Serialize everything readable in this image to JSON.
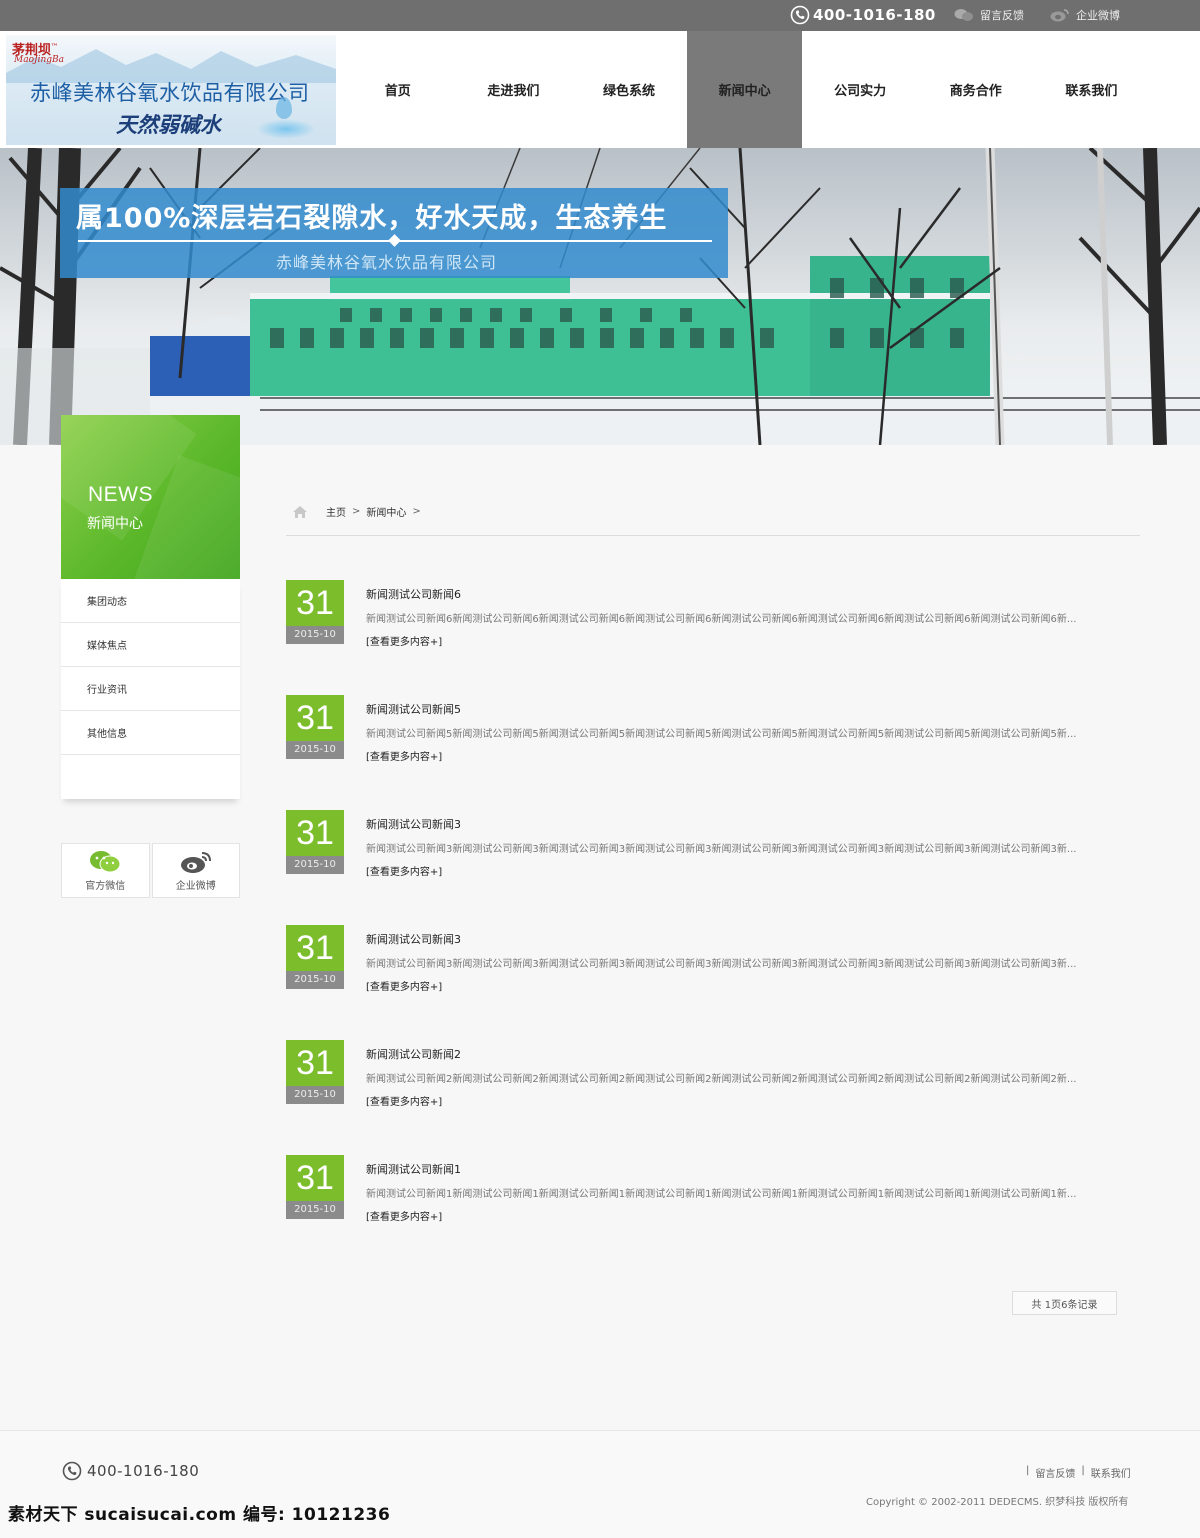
{
  "topbar": {
    "phone": "400-1016-180",
    "feedback": "留言反馈",
    "weibo": "企业微博"
  },
  "logo": {
    "brand_cn": "茅荆坝",
    "brand_tm": "™",
    "brand_en": "MaoJingBa",
    "company": "赤峰美林谷氧水饮品有限公司",
    "slogan": "天然弱碱水"
  },
  "nav": {
    "items": [
      "首页",
      "走进我们",
      "绿色系统",
      "新闻中心",
      "公司实力",
      "商务合作",
      "联系我们"
    ],
    "active_index": 3
  },
  "banner": {
    "headline": "属100%深层岩石裂隙水，好水天成，生态养生",
    "subline": "赤峰美林谷氧水饮品有限公司"
  },
  "sidebar": {
    "title_en": "NEWS",
    "title_cn": "新闻中心",
    "menu": [
      "集团动态",
      "媒体焦点",
      "行业资讯",
      "其他信息"
    ],
    "social": [
      {
        "label": "官方微信",
        "icon": "wechat-icon"
      },
      {
        "label": "企业微博",
        "icon": "weibo-icon"
      }
    ]
  },
  "breadcrumb": {
    "home": "主页",
    "current": "新闻中心",
    "separator": ">"
  },
  "news": [
    {
      "day": "31",
      "ym": "2015-10",
      "title": "新闻测试公司新闻6",
      "summary": "新闻测试公司新闻6新闻测试公司新闻6新闻测试公司新闻6新闻测试公司新闻6新闻测试公司新闻6新闻测试公司新闻6新闻测试公司新闻6新闻测试公司新闻6新...",
      "more": "[查看更多内容+]"
    },
    {
      "day": "31",
      "ym": "2015-10",
      "title": "新闻测试公司新闻5",
      "summary": "新闻测试公司新闻5新闻测试公司新闻5新闻测试公司新闻5新闻测试公司新闻5新闻测试公司新闻5新闻测试公司新闻5新闻测试公司新闻5新闻测试公司新闻5新...",
      "more": "[查看更多内容+]"
    },
    {
      "day": "31",
      "ym": "2015-10",
      "title": "新闻测试公司新闻3",
      "summary": "新闻测试公司新闻3新闻测试公司新闻3新闻测试公司新闻3新闻测试公司新闻3新闻测试公司新闻3新闻测试公司新闻3新闻测试公司新闻3新闻测试公司新闻3新...",
      "more": "[查看更多内容+]"
    },
    {
      "day": "31",
      "ym": "2015-10",
      "title": "新闻测试公司新闻3",
      "summary": "新闻测试公司新闻3新闻测试公司新闻3新闻测试公司新闻3新闻测试公司新闻3新闻测试公司新闻3新闻测试公司新闻3新闻测试公司新闻3新闻测试公司新闻3新...",
      "more": "[查看更多内容+]"
    },
    {
      "day": "31",
      "ym": "2015-10",
      "title": "新闻测试公司新闻2",
      "summary": "新闻测试公司新闻2新闻测试公司新闻2新闻测试公司新闻2新闻测试公司新闻2新闻测试公司新闻2新闻测试公司新闻2新闻测试公司新闻2新闻测试公司新闻2新...",
      "more": "[查看更多内容+]"
    },
    {
      "day": "31",
      "ym": "2015-10",
      "title": "新闻测试公司新闻1",
      "summary": "新闻测试公司新闻1新闻测试公司新闻1新闻测试公司新闻1新闻测试公司新闻1新闻测试公司新闻1新闻测试公司新闻1新闻测试公司新闻1新闻测试公司新闻1新...",
      "more": "[查看更多内容+]"
    }
  ],
  "pagination": {
    "text": "共 1页6条记录"
  },
  "footer": {
    "phone": "400-1016-180",
    "links": [
      "留言反馈",
      "联系我们"
    ],
    "separator": "|",
    "copyright": "Copyright © 2002-2011 DEDECMS. 织梦科技 版权所有"
  },
  "watermark": "素材天下 sucaisucai.com  编号: 10121236",
  "colors": {
    "topbar": "#6f6f6f",
    "nav_active": "#7a7a7a",
    "accent_green": "#7cbd2c",
    "banner_caption": "#338bce",
    "date_footer": "#8b8b8b"
  }
}
